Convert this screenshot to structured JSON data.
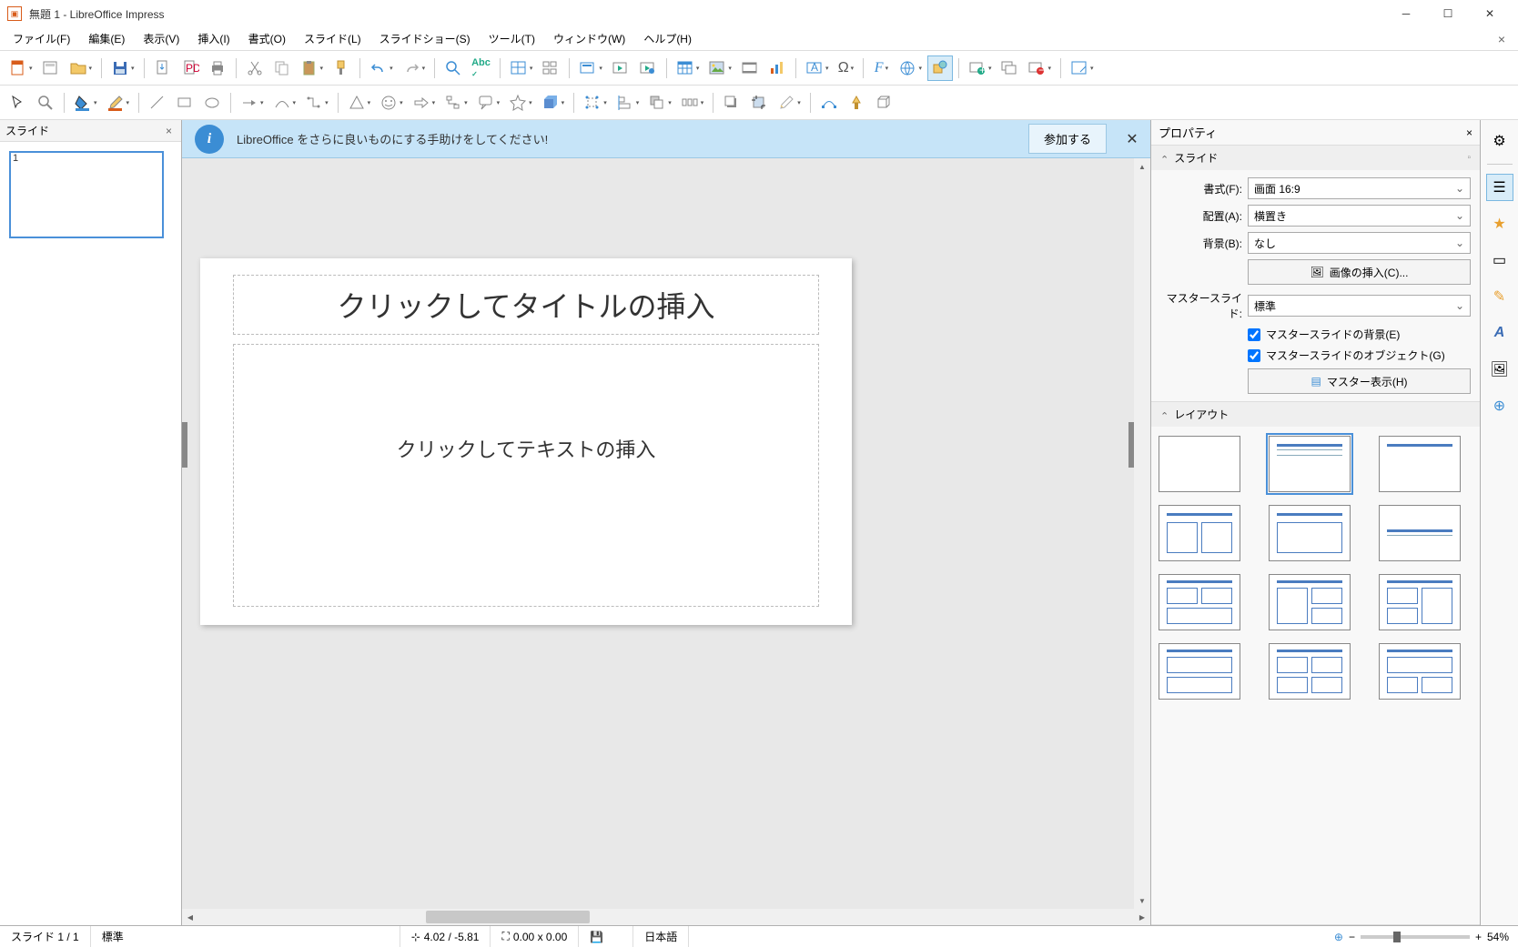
{
  "window": {
    "title": "無題 1 - LibreOffice Impress"
  },
  "menus": {
    "file": "ファイル(F)",
    "edit": "編集(E)",
    "view": "表示(V)",
    "insert": "挿入(I)",
    "format": "書式(O)",
    "slide": "スライド(L)",
    "slideshow": "スライドショー(S)",
    "tools": "ツール(T)",
    "window": "ウィンドウ(W)",
    "help": "ヘルプ(H)"
  },
  "panels": {
    "slides_label": "スライド",
    "props_label": "プロパティ"
  },
  "thumb": {
    "number": "1"
  },
  "info": {
    "message": "LibreOffice をさらに良いものにする手助けをしてください!",
    "button": "参加する"
  },
  "placeholders": {
    "title": "クリックしてタイトルの挿入",
    "body": "クリックしてテキストの挿入"
  },
  "props": {
    "section_slide": "スライド",
    "format_label": "書式(F):",
    "format_value": "画面 16:9",
    "orient_label": "配置(A):",
    "orient_value": "横置き",
    "bg_label": "背景(B):",
    "bg_value": "なし",
    "insert_image": "画像の挿入(C)...",
    "master_label": "マスタースライド:",
    "master_value": "標準",
    "master_bg": "マスタースライドの背景(E)",
    "master_obj": "マスタースライドのオブジェクト(G)",
    "master_view": "マスター表示(H)",
    "section_layout": "レイアウト"
  },
  "status": {
    "slide_count": "スライド 1 / 1",
    "template": "標準",
    "coords": "4.02 / -5.81",
    "size": "0.00 x 0.00",
    "lang": "日本語",
    "zoom": "54%"
  }
}
